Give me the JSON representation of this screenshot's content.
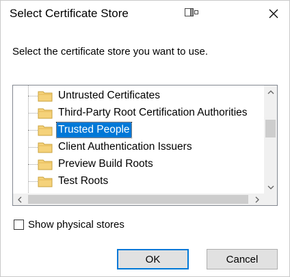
{
  "window": {
    "title": "Select Certificate Store",
    "title_icon": "window-dock-icon",
    "close_icon": "close-icon"
  },
  "prompt": "Select the certificate store you want to use.",
  "tree": {
    "items": [
      {
        "label": "Untrusted Certificates",
        "selected": false
      },
      {
        "label": "Third-Party Root Certification Authorities",
        "selected": false
      },
      {
        "label": "Trusted People",
        "selected": true
      },
      {
        "label": "Client Authentication Issuers",
        "selected": false
      },
      {
        "label": "Preview Build Roots",
        "selected": false
      },
      {
        "label": "Test Roots",
        "selected": false
      }
    ],
    "item_icon": "folder-icon"
  },
  "options": {
    "show_physical_label": "Show physical stores",
    "show_physical_checked": false
  },
  "buttons": {
    "ok": "OK",
    "cancel": "Cancel"
  },
  "colors": {
    "selection": "#0078d7",
    "folder": "#f5d27a",
    "button_face": "#e1e1e1"
  }
}
